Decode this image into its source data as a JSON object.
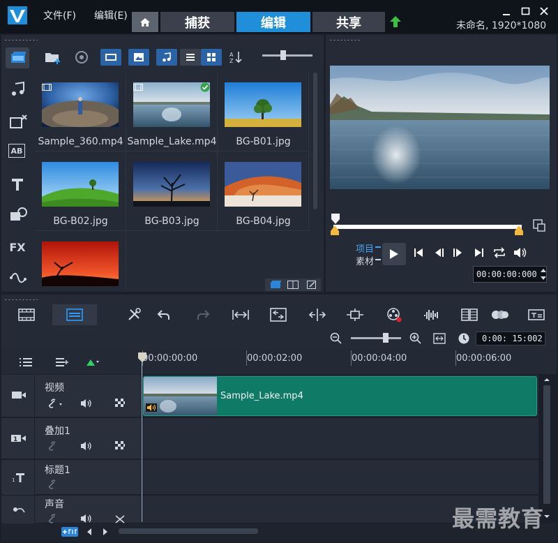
{
  "window": {
    "menu": [
      "文件(F)",
      "编辑(E)"
    ],
    "tabs": [
      "捕获",
      "编辑",
      "共享"
    ],
    "project_info": "未命名, 1920*1080"
  },
  "library": {
    "items": [
      {
        "label": "Sample_360.mp4",
        "type": "video"
      },
      {
        "label": "Sample_Lake.mp4",
        "type": "video",
        "checked": true
      },
      {
        "label": "BG-B01.jpg",
        "type": "image"
      },
      {
        "label": "BG-B02.jpg",
        "type": "image"
      },
      {
        "label": "BG-B03.jpg",
        "type": "image"
      },
      {
        "label": "BG-B04.jpg",
        "type": "image"
      },
      {
        "label": "",
        "type": "image"
      }
    ],
    "side_labels": {
      "title": "AB",
      "fx": "FX"
    }
  },
  "preview": {
    "label_project": "项目",
    "label_clip": "素材",
    "timecode": "00:00:00:000"
  },
  "timeline": {
    "timecode": "0:00: 15:002",
    "ruler": [
      "00:00:00:00",
      "00:00:02:00",
      "00:00:04:00",
      "00:00:06:00"
    ],
    "tracks": [
      {
        "name": "视频"
      },
      {
        "name": "叠加1"
      },
      {
        "name": "标题1"
      },
      {
        "name": "声音"
      }
    ],
    "clip_name": "Sample_Lake.mp4"
  },
  "watermark": "最需教育",
  "colors": {
    "accent": "#1e8fd8",
    "clip": "#0f7a66",
    "panel": "#252b36"
  }
}
